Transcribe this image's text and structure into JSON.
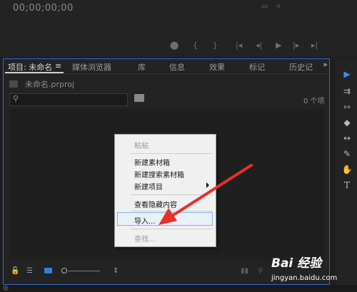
{
  "monitor": {
    "timecode": "00;00;00;00"
  },
  "tabs": [
    {
      "label": "项目: 未命名"
    },
    {
      "label": "媒体浏览器"
    },
    {
      "label": "库"
    },
    {
      "label": "信息"
    },
    {
      "label": "效果"
    },
    {
      "label": "标记"
    },
    {
      "label": "历史记"
    }
  ],
  "panel": {
    "menu_glyph": "≡",
    "overflow_glyph": "»",
    "project_file": "未命名.prproj",
    "item_count": "0 个项"
  },
  "context_menu": {
    "items": [
      {
        "label": "粘贴",
        "enabled": false
      },
      {
        "label": "新建素材箱",
        "enabled": true
      },
      {
        "label": "新建搜索素材箱",
        "enabled": true
      },
      {
        "label": "新建项目",
        "enabled": true,
        "submenu": true
      },
      {
        "label": "查看隐藏内容",
        "enabled": true
      },
      {
        "label": "导入...",
        "enabled": true,
        "highlighted": true
      },
      {
        "label": "查找...",
        "enabled": false
      }
    ]
  },
  "annotation": {
    "arrow_color": "#e8302a"
  },
  "watermark": {
    "logo": "Bai 经验",
    "url": "jingyan.baidu.com"
  },
  "colors": {
    "accent": "#2d6bd1",
    "background": "#1e1e1e",
    "panel": "#232323"
  }
}
